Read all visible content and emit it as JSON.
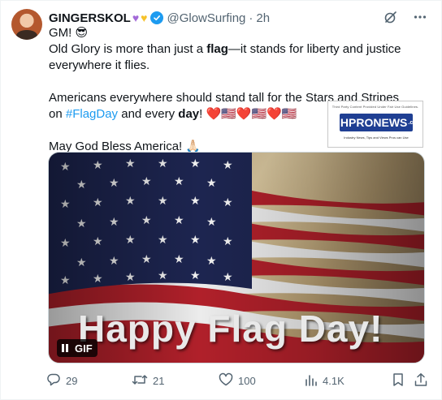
{
  "tweet": {
    "author_name": "GINGERSKOL",
    "name_emojis": [
      "purple-heart",
      "yellow-heart"
    ],
    "handle": "@GlowSurfing",
    "separator": "·",
    "time": "2h",
    "line1": "GM! 😎",
    "line2_before": "Old Glory is more than just a ",
    "line2_bold": "flag",
    "line2_after": "—it stands for liberty and justice everywhere it flies.",
    "line3_before": "Americans everywhere should stand tall for the Stars and Stripes on ",
    "hashtag": "#FlagDay",
    "line3_mid": " and every ",
    "line3_bold": "day",
    "line3_end": "! ",
    "emoji_row": [
      "❤️",
      "🇺🇸",
      "❤️",
      "🇺🇸",
      "❤️",
      "🇺🇸"
    ],
    "line4": "May God Bless America! 🙏🏻"
  },
  "watermark": {
    "top_text": "Third Party Content Provided Under Fair Use Guidelines.",
    "logo_mh": "MH",
    "logo_pro": "PRO",
    "logo_news": "NEWS",
    "logo_suffix": ".com",
    "sub_text": "Industry News, Tips and Views Pros can Use"
  },
  "media": {
    "overlay_text": "Happy Flag Day!",
    "badge_label": "GIF"
  },
  "actions": {
    "replies": "29",
    "reposts": "21",
    "likes": "100",
    "views": "4.1K"
  },
  "colors": {
    "accent": "#1d9bf0",
    "muted": "#536471",
    "text": "#0f1419",
    "heart_red": "#e8232f"
  },
  "icons": [
    "grok-icon",
    "more-icon",
    "verified-badge-icon",
    "reply-icon",
    "repost-icon",
    "like-icon",
    "views-icon",
    "bookmark-icon",
    "share-icon",
    "pause-icon"
  ]
}
